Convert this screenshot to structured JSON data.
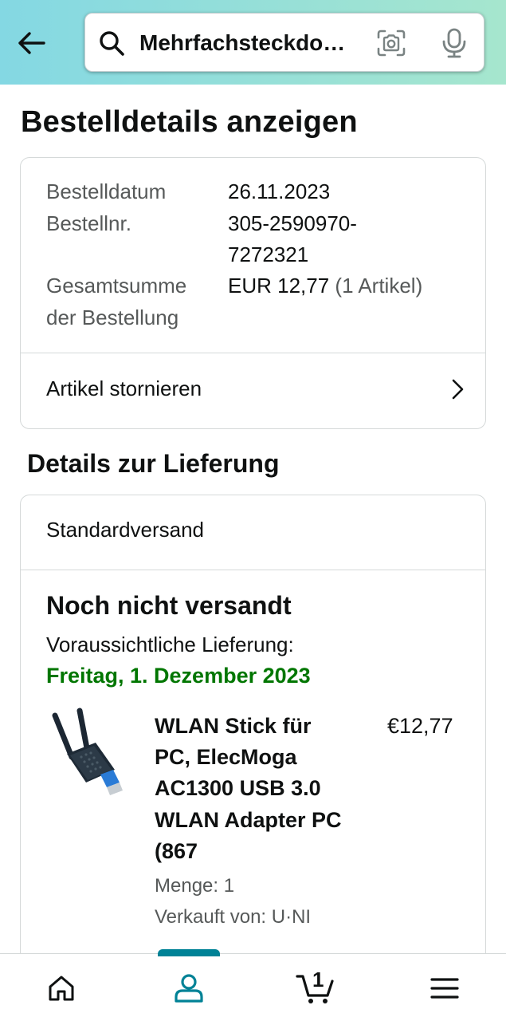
{
  "header": {
    "search_value": "Mehrfachsteckdo…",
    "gradient_start": "#84d8e3",
    "gradient_end": "#a6e6ce"
  },
  "icons": {
    "back": "arrow-left-icon",
    "search": "search-icon",
    "camera": "camera-scan-icon",
    "mic": "microphone-icon"
  },
  "page_title": "Bestelldetails anzeigen",
  "order_summary": {
    "date_label": "Bestelldatum",
    "date_value": "26.11.2023",
    "number_label": "Bestellnr.",
    "number_value_line1": "305-2590970-",
    "number_value_line2": "7272321",
    "total_label_line1": "Gesamtsumme",
    "total_label_line2": "der Bestellung",
    "total_value": "EUR 12,77",
    "total_count": "(1 Artikel)",
    "cancel_label": "Artikel stornieren"
  },
  "delivery_section": {
    "title": "Details zur Lieferung",
    "shipping_type": "Standardversand",
    "status": "Noch nicht versandt",
    "expected_label": "Voraussichtliche Lieferung:",
    "expected_date": "Freitag, 1. Dezember 2023",
    "accent_color": "#007600"
  },
  "product": {
    "title_lines": [
      "WLAN Stick für",
      "PC, ElecMoga",
      "AC1300 USB 3.0",
      "WLAN Adapter PC",
      "(867"
    ],
    "price": "€12,77",
    "quantity": "Menge: 1",
    "seller": "Verkauft von: U·NI"
  },
  "bottom_nav": {
    "cart_count": "1",
    "active_item": "account",
    "active_color": "#008296",
    "items": [
      "home-icon",
      "account-icon",
      "cart-icon",
      "menu-icon"
    ]
  }
}
